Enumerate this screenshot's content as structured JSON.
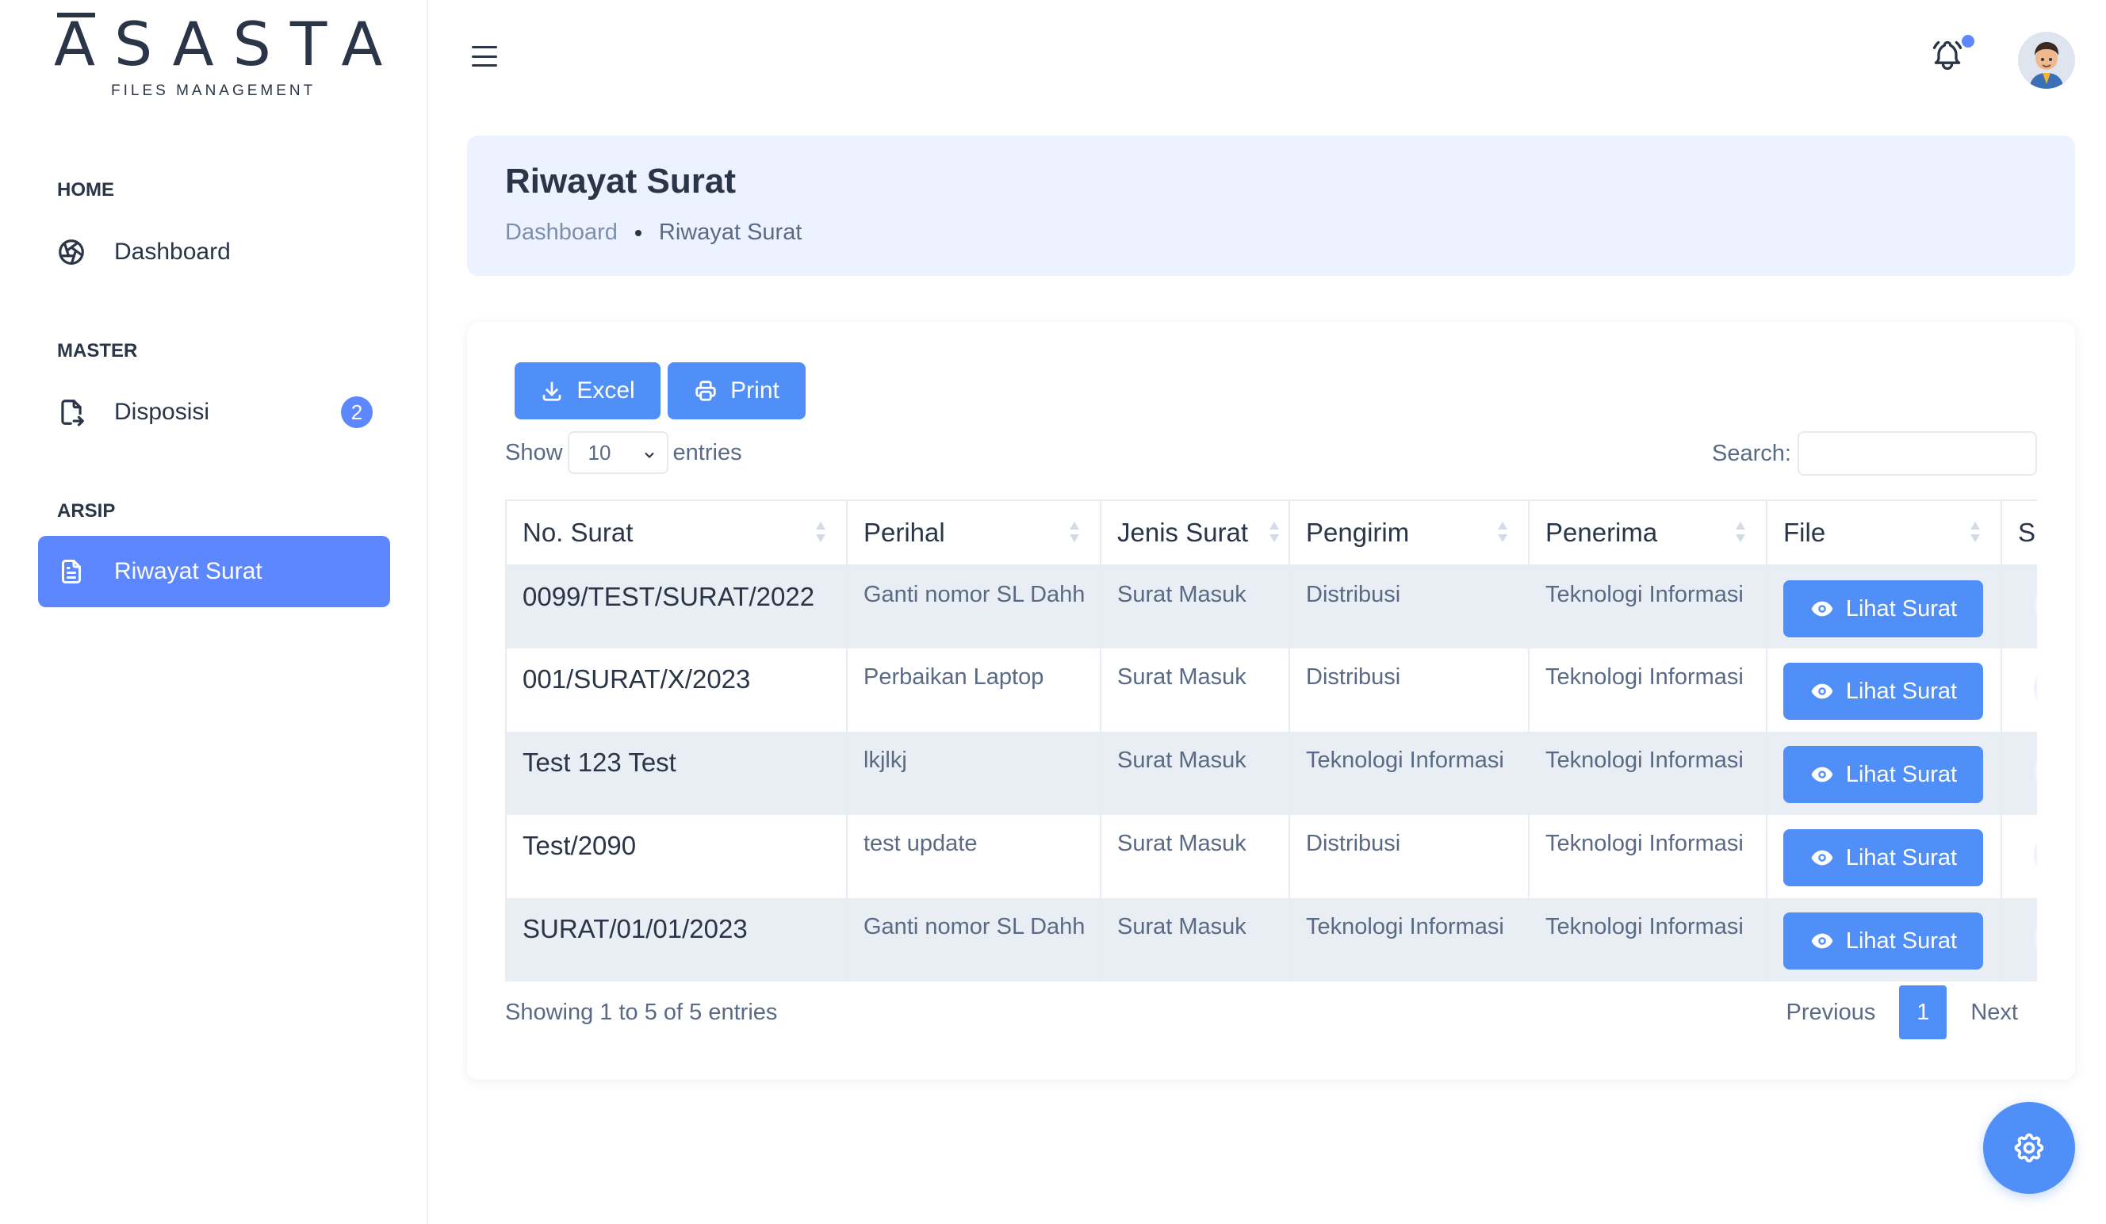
{
  "brand": {
    "name": "ASASTA",
    "tagline": "FILES MANAGEMENT"
  },
  "sidebar": {
    "sections": [
      {
        "caption": "HOME",
        "items": [
          {
            "label": "Dashboard",
            "icon": "aperture-icon"
          }
        ]
      },
      {
        "caption": "MASTER",
        "items": [
          {
            "label": "Disposisi",
            "icon": "file-export-icon",
            "badge": "2"
          }
        ]
      },
      {
        "caption": "ARSIP",
        "items": [
          {
            "label": "Riwayat Surat",
            "icon": "file-text-icon",
            "active": true
          }
        ]
      }
    ]
  },
  "topbar": {
    "notification_icon": "bell-icon",
    "has_notification": true
  },
  "header": {
    "title": "Riwayat Surat",
    "breadcrumb": [
      "Dashboard",
      "Riwayat Surat"
    ]
  },
  "toolbar": {
    "excel_label": "Excel",
    "print_label": "Print"
  },
  "length_menu": {
    "show_label": "Show",
    "selected": "10",
    "entries_label": "entries"
  },
  "search": {
    "label": "Search:",
    "value": ""
  },
  "table": {
    "columns": [
      "No. Surat",
      "Perihal",
      "Jenis Surat",
      "Pengirim",
      "Penerima",
      "File",
      "S"
    ],
    "action_label": "Lihat Surat",
    "rows": [
      {
        "no_surat": "0099/TEST/SURAT/2022",
        "perihal": "Ganti nomor SL Dahh",
        "jenis": "Surat Masuk",
        "pengirim": "Distribusi",
        "penerima": "Teknologi Informasi"
      },
      {
        "no_surat": "001/SURAT/X/2023",
        "perihal": "Perbaikan Laptop",
        "jenis": "Surat Masuk",
        "pengirim": "Distribusi",
        "penerima": "Teknologi Informasi"
      },
      {
        "no_surat": "Test 123 Test",
        "perihal": "lkjlkj",
        "jenis": "Surat Masuk",
        "pengirim": "Teknologi Informasi",
        "penerima": "Teknologi Informasi"
      },
      {
        "no_surat": "Test/2090",
        "perihal": "test update",
        "jenis": "Surat Masuk",
        "pengirim": "Distribusi",
        "penerima": "Teknologi Informasi"
      },
      {
        "no_surat": "SURAT/01/01/2023",
        "perihal": "Ganti nomor SL Dahh",
        "jenis": "Surat Masuk",
        "pengirim": "Teknologi Informasi",
        "penerima": "Teknologi Informasi"
      }
    ]
  },
  "footer": {
    "info": "Showing 1 to 5 of 5 entries",
    "previous": "Previous",
    "page": "1",
    "next": "Next"
  },
  "colors": {
    "primary": "#5d87ff",
    "button": "#4f8ff7",
    "header_bg": "#ecf2ff",
    "text": "#2a3547",
    "muted": "#5a6a85"
  },
  "fab_icon": "settings-gear-icon"
}
